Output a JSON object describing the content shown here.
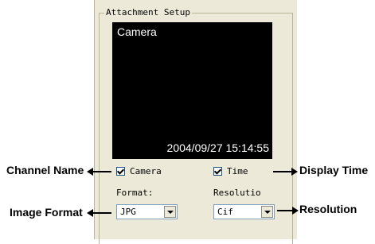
{
  "group": {
    "title": "Attachment Setup"
  },
  "preview": {
    "channel_text": "Camera",
    "timestamp": "2004/09/27 15:14:55"
  },
  "options": {
    "camera_label": "Camera",
    "camera_checked": true,
    "time_label": "Time",
    "time_checked": true
  },
  "format": {
    "label": "Format:",
    "value": "JPG"
  },
  "resolution": {
    "label": "Resolutio",
    "value": "Cif"
  },
  "callouts": {
    "channel_name": "Channel Name",
    "display_time": "Display Time",
    "image_format": "Image Format",
    "resolution": "Resolution"
  },
  "colors": {
    "panel_bg": "#ece9d8",
    "preview_bg": "#000000",
    "select_border": "#7f9db9"
  },
  "icons": [
    "checkbox-checked-icon",
    "dropdown-arrow-icon",
    "arrow-left-icon",
    "arrow-right-icon"
  ]
}
